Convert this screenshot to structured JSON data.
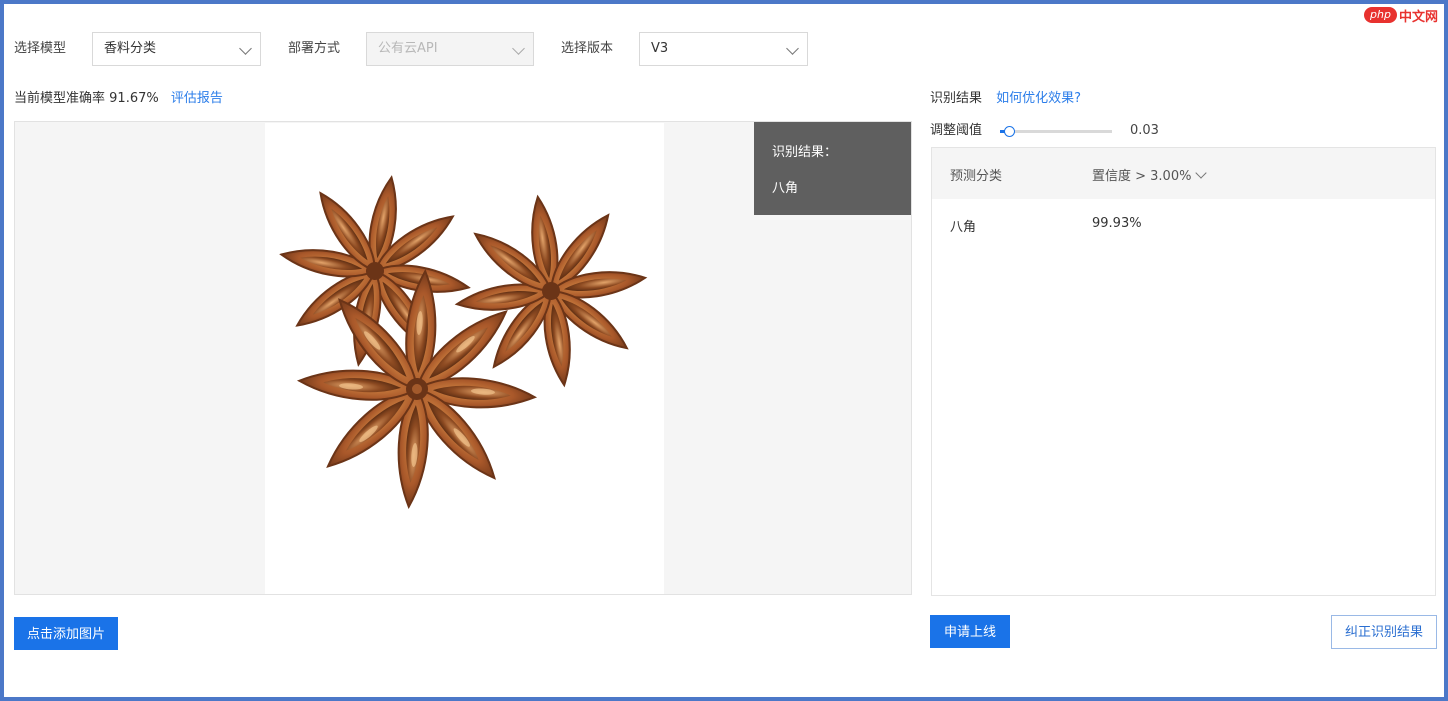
{
  "watermark": {
    "logo": "php",
    "text": "中文网"
  },
  "selectors": {
    "model": {
      "label": "选择模型",
      "value": "香料分类"
    },
    "deploy": {
      "label": "部署方式",
      "value": "公有云API"
    },
    "version": {
      "label": "选择版本",
      "value": "V3"
    }
  },
  "accuracy": {
    "label": "当前模型准确率",
    "value": "91.67%",
    "report_link": "评估报告"
  },
  "preview": {
    "overlay_title": "识别结果：",
    "overlay_value": "八角",
    "upload_button": "点击添加图片"
  },
  "results": {
    "title": "识别结果",
    "help_link": "如何优化效果?",
    "threshold": {
      "label": "调整阈值",
      "value": "0.03",
      "fraction": 0.03
    },
    "table": {
      "col_class": "预测分类",
      "col_conf": "置信度 > 3.00%",
      "rows": [
        {
          "class": "八角",
          "confidence": "99.93%"
        }
      ]
    },
    "apply_button": "申请上线",
    "correct_button": "纠正识别结果"
  },
  "colors": {
    "primary": "#1a73e8",
    "link": "#2b7de9",
    "frame": "#4c78c8",
    "overlay": "#5f5f5f",
    "anise_dark": "#7a3e1a",
    "anise_light": "#c7763a"
  }
}
